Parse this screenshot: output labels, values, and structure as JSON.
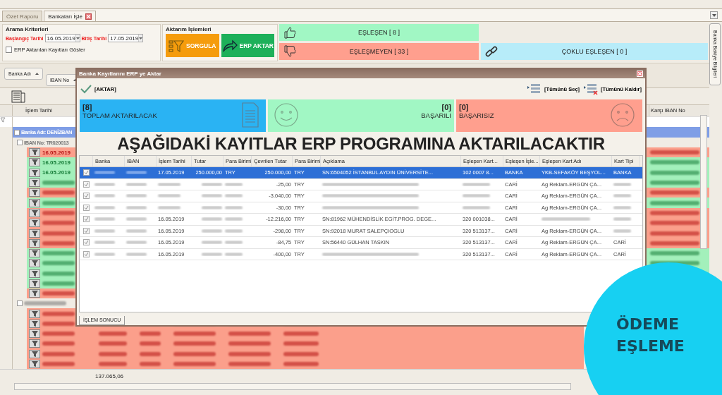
{
  "tabs": [
    {
      "label": "Özet Raporu",
      "selected": false,
      "closable": false
    },
    {
      "label": "Bankaları İşle",
      "selected": true,
      "closable": true
    }
  ],
  "search": {
    "title": "Arama Kriterleri",
    "start_label": "Başlangıç Tarihi",
    "start_value": "16.05.2019",
    "end_label": "Bitiş Tarihi",
    "end_value": "17.05.2019",
    "checkbox": {
      "label": "ERP Aktarılan Kayıtları Göster",
      "checked": false
    }
  },
  "actions": {
    "title": "Aktarım İşlemleri",
    "buttons": [
      {
        "label": "SORGULA",
        "kind": "query"
      },
      {
        "label": "ERP AKTAR",
        "kind": "export"
      }
    ]
  },
  "status_cards": [
    {
      "label": "EŞLEŞEN [ 8 ]",
      "kind": "matched"
    },
    {
      "label": "EŞLEŞMEYEN [ 33 ]",
      "kind": "unmatched"
    },
    {
      "label": "ÇOKLU EŞLEŞEN [ 0 ]",
      "kind": "multi"
    }
  ],
  "side_tab": "Banka Bakiye Bilgileri",
  "grid": {
    "group_chips": [
      "Banka Adı",
      "IBAN No"
    ],
    "column": "İşlem Tarihi",
    "right_column": "Karşı IBAN No",
    "group": "Banka Adı: DENİZBAN",
    "iban_groups": [
      "IBAN No: TR020013"
    ],
    "rows": [
      {
        "matched": false,
        "date": "16.05.2019"
      },
      {
        "matched": true,
        "date": "16.05.2019"
      },
      {
        "matched": true,
        "date": "16.05.2019"
      },
      {
        "matched": true
      },
      {
        "matched": false
      },
      {
        "matched": true
      },
      {
        "matched": false
      },
      {
        "matched": false
      },
      {
        "matched": false
      },
      {
        "matched": false
      },
      {
        "matched": true
      },
      {
        "matched": true
      },
      {
        "matched": true
      },
      {
        "matched": true
      },
      {
        "matched": false
      }
    ],
    "rows2": [
      {
        "matched": false
      },
      {
        "matched": false
      },
      {
        "matched": false
      },
      {
        "matched": false
      },
      {
        "matched": false
      },
      {
        "matched": false
      }
    ],
    "total": "137.065,06"
  },
  "dialog": {
    "title": "Banka Kayıtlarını ERP ye Aktar",
    "toolbar": [
      "[AKTAR]",
      "[Tümünü Seç]",
      "[Tümünü Kaldır]"
    ],
    "cards": [
      {
        "count": "[8]",
        "label": "TOPLAM AKTARILACAK",
        "kind": "total"
      },
      {
        "count": "[0]",
        "label": "BAŞARILI",
        "kind": "success"
      },
      {
        "count": "[0]",
        "label": "BAŞARISIZ",
        "kind": "fail"
      }
    ],
    "heading": "AŞAĞIDAKİ KAYITLAR ERP PROGRAMINA AKTARILACAKTIR",
    "columns": [
      "Banka",
      "IBAN",
      "İşlem Tarihi",
      "Tutar",
      "Para Birimi",
      "Çevrilen Tutar",
      "Para Birimi",
      "Açıklama",
      "Eşleşen Kart...",
      "Eşleşen İşle...",
      "Eşleşen Kart Adı",
      "Kart Tipi"
    ],
    "rows": [
      {
        "selected": true,
        "checked": true,
        "cells": [
          null,
          null,
          "17.05.2019",
          "250.000,00",
          "TRY",
          "250.000,00",
          "TRY",
          "SN:6504052 İSTANBUL AYDIN ÜNİVERSİTE...",
          "102 0007 8...",
          "BANKA",
          "YKB-SEFAKÖY BEŞYOL...",
          "BANKA"
        ]
      },
      {
        "selected": false,
        "checked": true,
        "cells": [
          null,
          null,
          null,
          null,
          null,
          "-25,00",
          "TRY",
          null,
          null,
          "CARİ",
          "Ag Reklam-ERGÜN ÇA...",
          null
        ]
      },
      {
        "selected": false,
        "checked": true,
        "cells": [
          null,
          null,
          null,
          null,
          null,
          "-3.040,00",
          "TRY",
          null,
          null,
          "CARİ",
          "Ag Reklam-ERGÜN ÇA...",
          null
        ]
      },
      {
        "selected": false,
        "checked": true,
        "cells": [
          null,
          null,
          null,
          null,
          null,
          "-30,00",
          "TRY",
          null,
          null,
          "CARİ",
          "Ag Reklam-ERGÜN ÇA...",
          null
        ]
      },
      {
        "selected": false,
        "checked": true,
        "cells": [
          null,
          null,
          "16.05.2019",
          null,
          null,
          "-12.216,00",
          "TRY",
          "SN:81962 MÜHENDİSLİK EGİT.PROG. DEGE...",
          "320 001038...",
          "CARİ",
          null,
          null
        ]
      },
      {
        "selected": false,
        "checked": true,
        "cells": [
          null,
          null,
          "16.05.2019",
          null,
          null,
          "-298,00",
          "TRY",
          "SN:92018 MURAT SALEPÇIOGLU",
          "320 513137...",
          "CARİ",
          "Ag Reklam-ERGÜN ÇA...",
          null
        ]
      },
      {
        "selected": false,
        "checked": true,
        "cells": [
          null,
          null,
          "16.05.2019",
          null,
          null,
          "-84,75",
          "TRY",
          "SN:56440 GÜLHAN TASKIN",
          "320 513137...",
          "CARİ",
          "Ag Reklam-ERGÜN ÇA...",
          "CARİ"
        ]
      },
      {
        "selected": false,
        "checked": true,
        "cells": [
          null,
          null,
          "16.05.2019",
          null,
          null,
          "-400,00",
          "TRY",
          null,
          "320 513137...",
          "CARİ",
          "Ag Reklam-ERGÜN ÇA...",
          "CARİ"
        ]
      }
    ],
    "bottom_tab": "İŞLEM SONUCU"
  },
  "badge": [
    "ÖDEME",
    "EŞLEME"
  ]
}
